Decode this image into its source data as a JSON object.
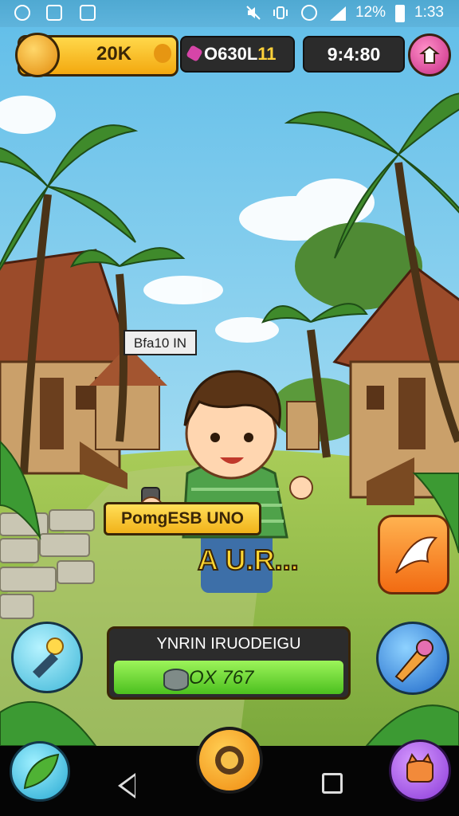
{
  "status_bar": {
    "battery": "12%",
    "time": "1:33",
    "icons": [
      "gallery-icon",
      "chart-icon",
      "calendar-icon",
      "mute-icon",
      "vibrate-icon",
      "data-saver-icon",
      "signal-icon",
      "battery-icon"
    ]
  },
  "hud": {
    "coins": "20K",
    "code_prefix": "O630L",
    "code_suffix": "11",
    "timer": "9:4:80"
  },
  "scene": {
    "sign_text": "Bfa10 IN",
    "banner_text": "PomgESB UNO",
    "auto_text": "A U.R...",
    "character": "boy-holding-phone"
  },
  "panel": {
    "title": "YNRIN IRUODEIGU",
    "value": "OX 767"
  },
  "colors": {
    "sky": "#6fc2e8",
    "grass": "#86b84a",
    "gold": "#f3b31a",
    "dark": "#2b2b2b",
    "green_bar": "#6fd93a"
  },
  "buttons": [
    "idea-button",
    "tool-button",
    "share-button",
    "home-button",
    "leaf-button",
    "pig-button"
  ]
}
